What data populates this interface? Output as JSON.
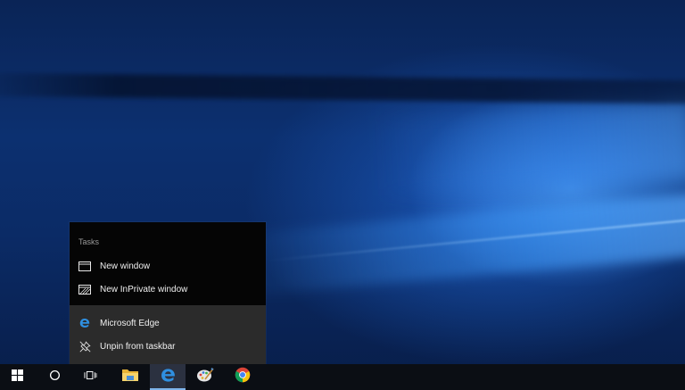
{
  "jump_list": {
    "tasks_header": "Tasks",
    "tasks": [
      {
        "label": "New window",
        "icon": "window-icon"
      },
      {
        "label": "New InPrivate window",
        "icon": "inprivate-window-icon"
      }
    ],
    "pinned": [
      {
        "label": "Microsoft Edge",
        "icon": "edge-icon"
      },
      {
        "label": "Unpin from taskbar",
        "icon": "unpin-icon"
      }
    ]
  },
  "taskbar": {
    "items": [
      {
        "name": "start-button",
        "icon": "windows-logo-icon"
      },
      {
        "name": "cortana-button",
        "icon": "cortana-circle-icon"
      },
      {
        "name": "task-view-button",
        "icon": "task-view-icon"
      },
      {
        "name": "file-explorer",
        "icon": "folder-icon"
      },
      {
        "name": "microsoft-edge",
        "icon": "edge-icon",
        "active": true
      },
      {
        "name": "paint-app",
        "icon": "paint-icon"
      },
      {
        "name": "google-chrome",
        "icon": "chrome-icon"
      }
    ]
  },
  "colors": {
    "edge_blue": "#2f8fe0",
    "accent_underline": "#7eb4ea",
    "taskbar_bg": "#0b0e14",
    "menu_bg": "#050505",
    "pinned_bg": "#2b2b2b"
  }
}
